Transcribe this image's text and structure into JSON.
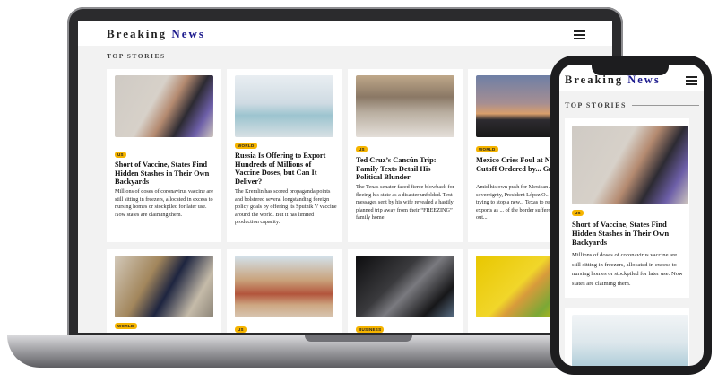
{
  "brand": {
    "name_part1": "Breaking",
    "name_part2": "News"
  },
  "section_title": "TOP STORIES",
  "colors": {
    "brand_accent": "#1c1a8d",
    "badge": "#f5b400"
  },
  "articles": [
    {
      "badge": "US",
      "title": "Short of Vaccine, States Find Hidden Stashes in Their Own Backyards",
      "body": "Millions of doses of coronavirus vaccine are still sitting in freezers, allocated in excess to nursing homes or stockpiled for later use. Now states are claiming them.",
      "image": "vaccine-photo"
    },
    {
      "badge": "WORLD",
      "title": "Russia Is Offering to Export Hundreds of Millions of Vaccine Doses, but Can It Deliver?",
      "body": "The Kremlin has scored propaganda points and bolstered several longstanding foreign policy goals by offering its Sputnik V vaccine around the world. But it has limited production capacity.",
      "image": "lab-photo"
    },
    {
      "badge": "US",
      "title": "Ted Cruz’s Cancún Trip: Family Texts Detail His Political Blunder",
      "body": "The Texas senator faced fierce blowback for fleeing his state as a disaster unfolded. Text messages sent by his wife revealed a hastily planned trip away from their “FREEZING” family home.",
      "image": "airport-photo"
    },
    {
      "badge": "WORLD",
      "title": "Mexico Cries Foul at N... Gas Cutoff Ordered by... Governor",
      "body": "Amid his own push for Mexican ... sovereignty, President López O... said he was trying to stop a new... Texas to restrict gas exports as ... of the border suffered mass out...",
      "image": "sunset-photo"
    },
    {
      "badge": "WORLD",
      "title": "",
      "body": "",
      "image": "office-photo"
    },
    {
      "badge": "US",
      "title": "",
      "body": "",
      "image": "desert-photo"
    },
    {
      "badge": "BUSINESS",
      "title": "",
      "body": "",
      "image": "car-photo"
    },
    {
      "badge": "",
      "title": "",
      "body": "",
      "image": "box-photo"
    }
  ],
  "mobile": {
    "brand_part1": "Breaking",
    "brand_part2": "News",
    "section_title": "TOP STORIES",
    "article": {
      "badge": "US",
      "title": "Short of Vaccine, States Find Hidden Stashes in Their Own Backyards",
      "body": "Millions of doses of coronavirus vaccine are still sitting in freezers, allocated in excess to nursing homes or stockpiled for later use. Now states are claiming them."
    }
  }
}
